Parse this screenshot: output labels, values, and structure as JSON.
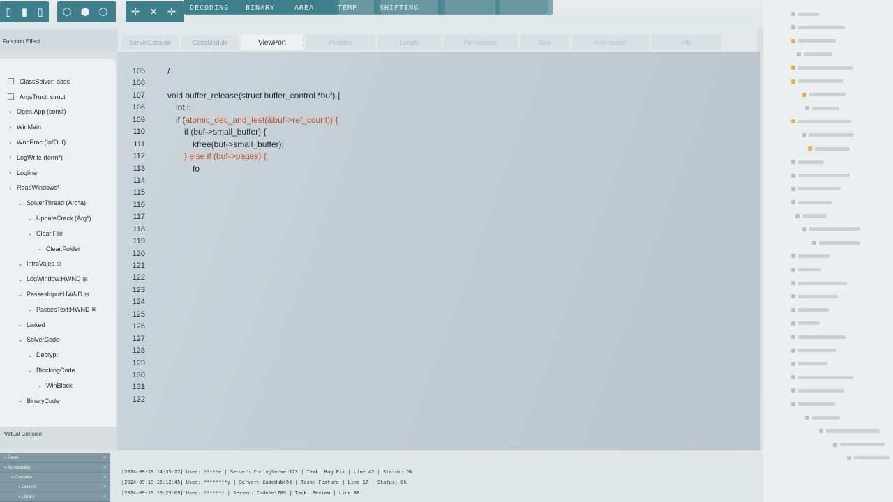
{
  "toolbar": {
    "icons_group1": [
      "file-icon",
      "document-icon",
      "pages-icon"
    ],
    "icons_group2": [
      "cube-icon",
      "cube-solid-icon",
      "box-icon"
    ],
    "icons_group3": [
      "move-icon",
      "cross-icon",
      "add-icon"
    ],
    "tabs": [
      "DECODING",
      "BINARY",
      "AREA",
      "TEMP",
      "SHIFTING",
      "",
      ""
    ]
  },
  "function_label": "Function Effect",
  "tabs": [
    {
      "label": "ServerConsole",
      "state": "inactive"
    },
    {
      "label": "CodeModule",
      "state": "inactive"
    },
    {
      "label": "ViewPort",
      "state": "active"
    },
    {
      "label": "Position",
      "state": "hidden"
    },
    {
      "label": "Length",
      "state": "hidden"
    },
    {
      "label": "Permissions",
      "state": "hidden"
    },
    {
      "label": "Size",
      "state": "hidden"
    },
    {
      "label": "Information",
      "state": "hidden"
    },
    {
      "label": "Info",
      "state": "hidden"
    }
  ],
  "tree": [
    {
      "label": "ClassSolver: dass",
      "level": 0,
      "marker": "box"
    },
    {
      "label": "ArgsTruct: struct",
      "level": 0,
      "marker": "box"
    },
    {
      "label": "Open.App (const)",
      "level": 0,
      "marker": "›"
    },
    {
      "label": "WinMain",
      "level": 0,
      "marker": "›"
    },
    {
      "label": "WndProc (In/Out)",
      "level": 0,
      "marker": "›"
    },
    {
      "label": "LogWrite (form*)",
      "level": 0,
      "marker": "›"
    },
    {
      "label": "Logline",
      "level": 0,
      "marker": "›"
    },
    {
      "label": "ReadWindows*",
      "level": 0,
      "marker": "›"
    },
    {
      "label": "SolverThread (Arg*a)",
      "level": 1,
      "marker": "⌄"
    },
    {
      "label": "UpdateCrack (Arg*)",
      "level": 2,
      "marker": "⌄"
    },
    {
      "label": "Clear.File",
      "level": 2,
      "marker": "⌄"
    },
    {
      "label": "Clear.Folder",
      "level": 3,
      "marker": "⌄"
    },
    {
      "label": "IntroVajes",
      "level": 1,
      "marker": "⌄",
      "grid": "⊞"
    },
    {
      "label": "LogWindow:HWND",
      "level": 1,
      "marker": "⌄",
      "grid": "⊞"
    },
    {
      "label": "PassesInput:HWND",
      "level": 1,
      "marker": "⌄",
      "grid": "⊞"
    },
    {
      "label": "PassesText:HWND",
      "level": 2,
      "marker": "⌄",
      "grid": "⊞"
    },
    {
      "label": "Linked",
      "level": 1,
      "marker": "⌄"
    },
    {
      "label": "SolverCode",
      "level": 1,
      "marker": "⌄"
    },
    {
      "label": "Decrypt",
      "level": 2,
      "marker": "⌄"
    },
    {
      "label": "BlockingCode",
      "level": 2,
      "marker": "⌄"
    },
    {
      "label": "WinBlock",
      "level": 3,
      "marker": "⌄"
    },
    {
      "label": "BinaryCode",
      "level": 1,
      "marker": "⌄"
    }
  ],
  "editor": {
    "line_numbers": [
      "105",
      "106",
      "107",
      "108",
      "109",
      "110",
      "111",
      "112",
      "113",
      "114",
      "115",
      "116",
      "117",
      "118",
      "119",
      "120",
      "121",
      "122",
      "123",
      "124",
      "125",
      "126",
      "127",
      "128",
      "129",
      "130",
      "131",
      "132"
    ],
    "code_lines": [
      {
        "indent": 0,
        "parts": [
          {
            "t": "/",
            "h": false
          }
        ]
      },
      {
        "indent": 0,
        "parts": []
      },
      {
        "indent": 0,
        "parts": [
          {
            "t": "void buffer_release(struct buffer_control *buf) {",
            "h": false
          }
        ]
      },
      {
        "indent": 1,
        "parts": [
          {
            "t": "int i;",
            "h": false
          }
        ]
      },
      {
        "indent": 1,
        "parts": [
          {
            "t": "if (",
            "h": false
          },
          {
            "t": "atomic_dec_and_test(&buf->ref_count)) {",
            "h": true
          }
        ]
      },
      {
        "indent": 2,
        "parts": [
          {
            "t": "if (buf->small_buffer) {",
            "h": false
          }
        ]
      },
      {
        "indent": 3,
        "parts": [
          {
            "t": "kfree(buf->small_buffer);",
            "h": false
          }
        ]
      },
      {
        "indent": 2,
        "parts": [
          {
            "t": "} else if (buf->pages) {",
            "h": true
          }
        ]
      },
      {
        "indent": 3,
        "parts": [
          {
            "t": "fo",
            "h": false
          }
        ]
      }
    ],
    "highlight_color": "#c0512d"
  },
  "virtual_console_label": "Virtual Console",
  "bottom_tree": [
    {
      "label": "Panel",
      "level": 0
    },
    {
      "label": "Accessibility",
      "level": 0
    },
    {
      "label": "Overview",
      "level": 1
    },
    {
      "label": "Options",
      "level": 2
    },
    {
      "label": "Library",
      "level": 2
    }
  ],
  "logs": [
    "[2024-09-19 14:35:22] User: *****e | Server: CodingServer123 | Task: Bug Fix | Line 42 | Status: Ok",
    "[2024-09-19 15:12:45] User: ********y | Server: CodeHub456 | Task: Feature | Line 17 | Status: Ok",
    "[2024-09-19 16:23:09] User: ******* | Server: CodeNet789 | Task: Review | Line 88"
  ],
  "colors": {
    "accent": "#3f7f8b",
    "editor_bg": "#c2ccd2",
    "warn": "#e3b44a"
  }
}
